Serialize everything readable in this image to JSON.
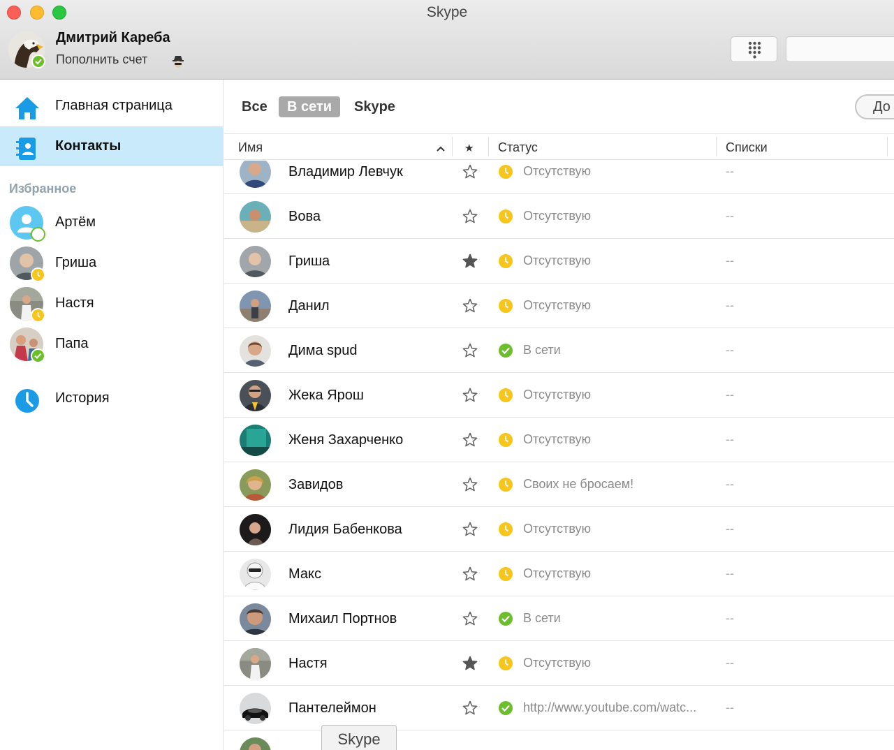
{
  "window": {
    "title": "Skype"
  },
  "profile": {
    "name": "Дмитрий Кареба",
    "subtitle": "Пополнить счет",
    "status_color": "#6cbe2b"
  },
  "sidebar": {
    "nav": [
      {
        "label": "Главная страница",
        "icon": "home-icon"
      },
      {
        "label": "Контакты",
        "icon": "contacts-icon",
        "active": true
      }
    ],
    "favorites_header": "Избранное",
    "favorites": [
      {
        "name": "Артём",
        "status": "offline"
      },
      {
        "name": "Гриша",
        "status": "away"
      },
      {
        "name": "Настя",
        "status": "away"
      },
      {
        "name": "Папа",
        "status": "online"
      }
    ],
    "history_label": "История"
  },
  "filters": [
    {
      "label": "Все"
    },
    {
      "label": "В сети",
      "active": true
    },
    {
      "label": "Skype"
    }
  ],
  "add_button_label": "До",
  "table": {
    "headers": {
      "name": "Имя",
      "star": "★",
      "status": "Статус",
      "lists": "Списки"
    },
    "rows": [
      {
        "name": "Владимир Левчук",
        "favorite": false,
        "status": "away",
        "status_text": "Отсутствую",
        "lists": "--"
      },
      {
        "name": "Вова",
        "favorite": false,
        "status": "away",
        "status_text": "Отсутствую",
        "lists": "--"
      },
      {
        "name": "Гриша",
        "favorite": true,
        "status": "away",
        "status_text": "Отсутствую",
        "lists": "--"
      },
      {
        "name": "Данил",
        "favorite": false,
        "status": "away",
        "status_text": "Отсутствую",
        "lists": "--"
      },
      {
        "name": "Дима spud",
        "favorite": false,
        "status": "online",
        "status_text": "В сети",
        "lists": "--"
      },
      {
        "name": "Жека Ярош",
        "favorite": false,
        "status": "away",
        "status_text": "Отсутствую",
        "lists": "--"
      },
      {
        "name": "Женя Захарченко",
        "favorite": false,
        "status": "away",
        "status_text": "Отсутствую",
        "lists": "--"
      },
      {
        "name": "Завидов",
        "favorite": false,
        "status": "away",
        "status_text": "Своих не бросаем!",
        "lists": "--"
      },
      {
        "name": "Лидия Бабенкова",
        "favorite": false,
        "status": "away",
        "status_text": "Отсутствую",
        "lists": "--"
      },
      {
        "name": "Макс",
        "favorite": false,
        "status": "away",
        "status_text": "Отсутствую",
        "lists": "--"
      },
      {
        "name": "Михаил Портнов",
        "favorite": false,
        "status": "online",
        "status_text": "В сети",
        "lists": "--"
      },
      {
        "name": "Настя",
        "favorite": true,
        "status": "away",
        "status_text": "Отсутствую",
        "lists": "--"
      },
      {
        "name": "Пантелеймон",
        "favorite": false,
        "status": "online",
        "status_text": "http://www.youtube.com/watc...",
        "lists": "--"
      }
    ]
  },
  "tooltip": "Skype",
  "colors": {
    "away": "#f8c51c",
    "online": "#6cbe2b",
    "accent": "#00aff0",
    "active_nav_bg": "#c8eafa"
  }
}
